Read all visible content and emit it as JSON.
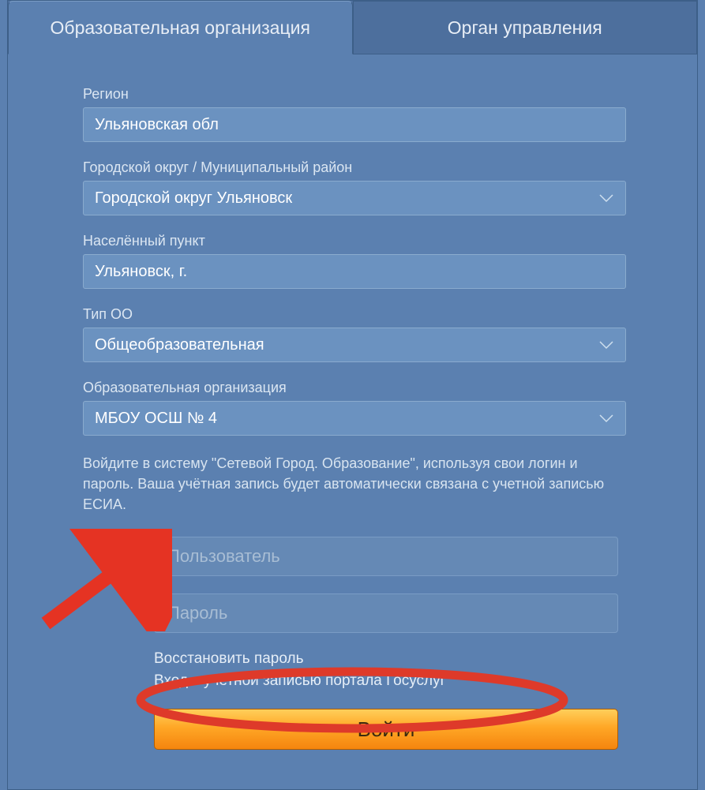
{
  "tabs": {
    "org": "Образовательная организация",
    "gov": "Орган управления"
  },
  "fields": {
    "region_label": "Регион",
    "region_value": "Ульяновская обл",
    "district_label": "Городской округ / Муниципальный район",
    "district_value": "Городской округ Ульяновск",
    "locality_label": "Населённый пункт",
    "locality_value": "Ульяновск, г.",
    "type_label": "Тип ОО",
    "type_value": "Общеобразовательная",
    "org_label": "Образовательная организация",
    "org_value": "МБОУ ОСШ № 4"
  },
  "info": "Войдите в систему \"Сетевой Город. Образование\", используя свои логин и пароль. Ваша учётная запись будет автоматически связана с учетной записью ЕСИА.",
  "credentials": {
    "user_placeholder": "Пользователь",
    "pass_placeholder": "Пароль"
  },
  "links": {
    "recover": "Восстановить пароль",
    "esia": "Вход с учетной записью портала Госуслуг"
  },
  "login_button": "Войти"
}
